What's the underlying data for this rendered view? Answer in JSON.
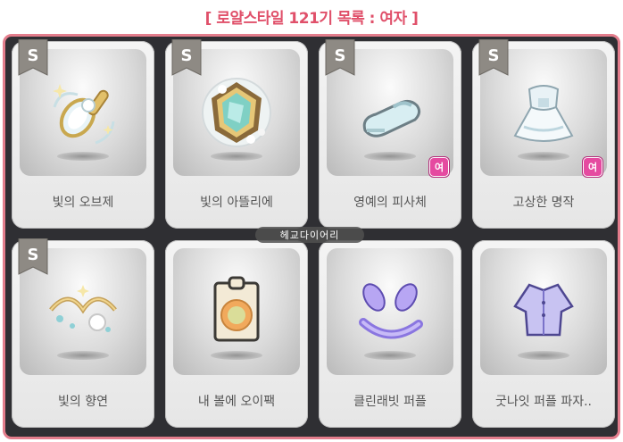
{
  "header": {
    "title": "[ 로얄스타일 121기 목록 : 여자 ]"
  },
  "items": [
    {
      "name": "빛의 오브제",
      "rank": "S",
      "badge": ""
    },
    {
      "name": "빛의 아뜰리에",
      "rank": "S",
      "badge": ""
    },
    {
      "name": "영예의 피사체",
      "rank": "S",
      "badge": "여"
    },
    {
      "name": "고상한 명작",
      "rank": "S",
      "badge": "여"
    },
    {
      "name": "빛의 향연",
      "rank": "S",
      "badge": ""
    },
    {
      "name": "내 볼에 오이팩",
      "rank": "",
      "badge": ""
    },
    {
      "name": "클린래빗 퍼플",
      "rank": "",
      "badge": ""
    },
    {
      "name": "굿나잇 퍼플 파자..",
      "rank": "",
      "badge": ""
    }
  ],
  "watermark": "헤교다이어리",
  "colors": {
    "frame": "#e37d8c",
    "title": "#e0506a",
    "badge": "#e54aa0"
  }
}
